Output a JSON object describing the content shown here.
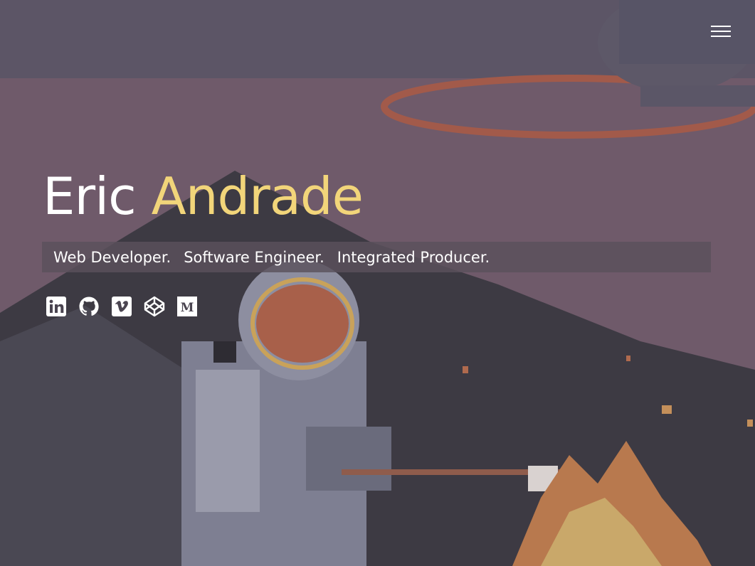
{
  "header": {
    "menu_icon": "hamburger-menu-icon"
  },
  "hero": {
    "first_name": "Eric",
    "last_name": "Andrade",
    "name_colors": {
      "first": "#ffffff",
      "last": "#f2d57a"
    },
    "roles": [
      "Web Developer.",
      "Software Engineer.",
      "Integrated Producer."
    ]
  },
  "social": [
    {
      "icon": "linkedin-icon"
    },
    {
      "icon": "github-icon"
    },
    {
      "icon": "vimeo-icon"
    },
    {
      "icon": "codepen-icon"
    },
    {
      "icon": "medium-icon"
    }
  ]
}
